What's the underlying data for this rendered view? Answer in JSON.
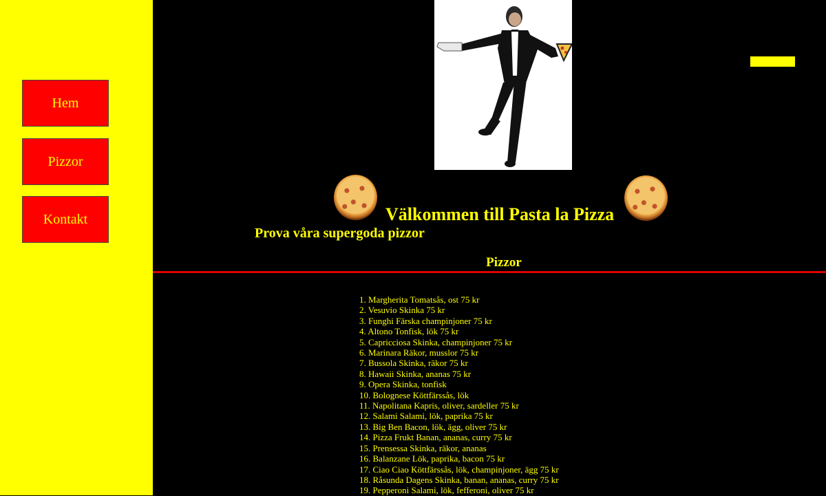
{
  "nav": {
    "items": [
      {
        "label": "Hem"
      },
      {
        "label": "Pizzor"
      },
      {
        "label": "Kontakt"
      }
    ]
  },
  "header": {
    "welcome": "Välkommen till Pasta la Pizza",
    "subtitle": "Prova våra supergoda pizzor"
  },
  "section": {
    "title": "Pizzor"
  },
  "menu": {
    "items": [
      "1. Margherita Tomatsås, ost 75 kr",
      "2. Vesuvio Skinka 75 kr",
      "3. Funghi Färska champinjoner 75 kr",
      "4. Altono Tonfisk, lök 75 kr",
      "5. Capricciosa Skinka, champinjoner 75 kr",
      "6. Marinara Räkor, musslor 75 kr",
      "7. Bussola Skinka, räkor 75 kr",
      "8. Hawaii Skinka, ananas 75 kr",
      "9. Opera Skinka, tonfisk",
      "10. Bolognese Köttfärssås, lök",
      "11. Napolitana Kapris, oliver, sardeller 75 kr",
      "12. Salami Salami, lök, paprika 75 kr",
      "13. Big Ben Bacon, lök, ägg, oliver 75 kr",
      "14. Pizza Frukt Banan, ananas, curry 75 kr",
      "15. Prensessa Skinka, räkor, ananas",
      "16. Balanzane Lök, paprika, bacon 75 kr",
      "17. Ciao Ciao Köttfärssås, lök, champinjoner, ägg 75 kr",
      "18. Råsunda Dagens Skinka, banan, ananas, curry 75 kr",
      "19. Pepperoni Salami, lök, fefferoni, oliver 75 kr"
    ]
  },
  "colors": {
    "sidebar": "#ffff00",
    "button": "#ff0000",
    "text": "#ffff00",
    "background": "#000000",
    "rule": "#e00000"
  }
}
